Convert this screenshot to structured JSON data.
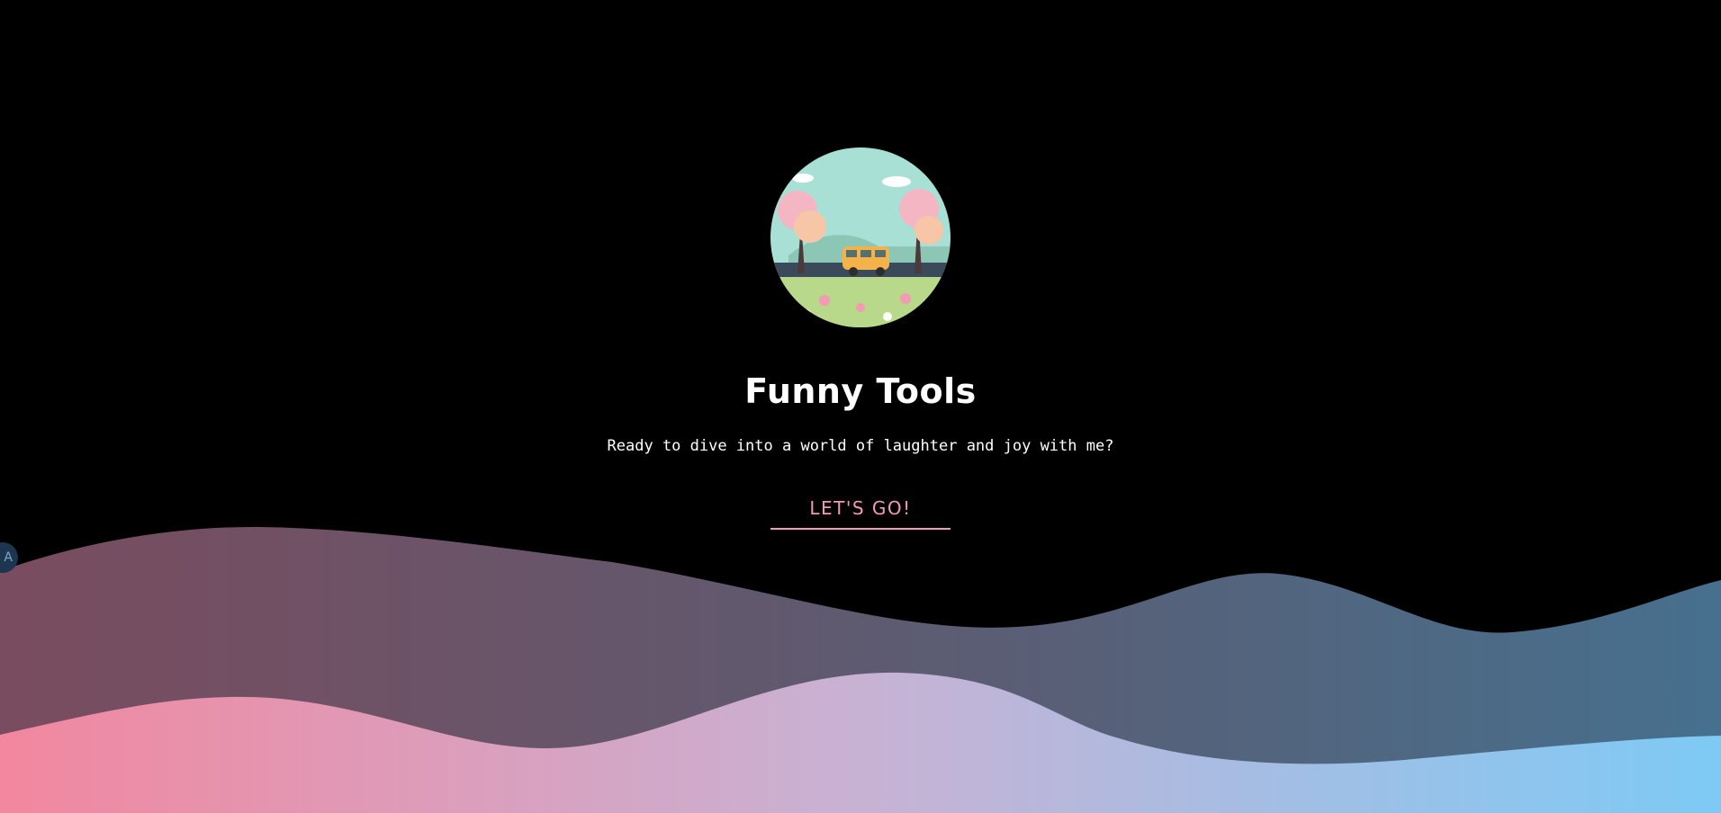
{
  "hero": {
    "title": "Funny Tools",
    "subtitle": "Ready to dive into a world of laughter and joy with me?",
    "cta_label": "LET'S GO!"
  },
  "side_badge": {
    "label": "A"
  },
  "colors": {
    "background": "#000000",
    "accent": "#f19bb6",
    "wave_back_start": "#7a4c5f",
    "wave_back_end": "#46708e",
    "wave_front_start": "#f2879f",
    "wave_front_mid": "#c8b2d4",
    "wave_front_end": "#7dcaf5"
  },
  "icons": {
    "avatar": "van-landscape-illustration"
  }
}
